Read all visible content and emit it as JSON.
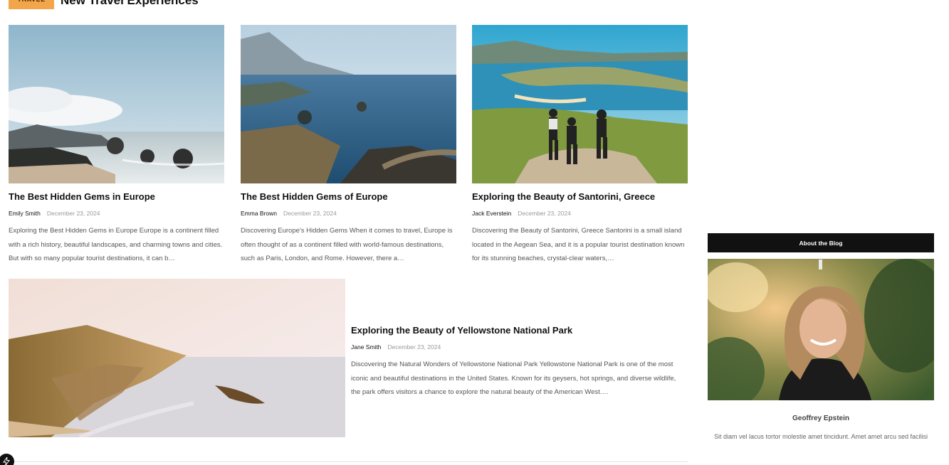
{
  "section": {
    "badge": "TRAVEL",
    "title": "New Travel Experiences"
  },
  "posts": [
    {
      "title": "The Best Hidden Gems in Europe",
      "author": "Emily Smith",
      "date": "December 23, 2024",
      "excerpt": "Exploring the Best Hidden Gems in Europe Europe is a continent filled with a rich history, beautiful landscapes, and charming towns and cities. But with so many popular tourist destinations, it can b…"
    },
    {
      "title": "The Best Hidden Gems of Europe",
      "author": "Emma Brown",
      "date": "December 23, 2024",
      "excerpt": "Discovering Europe's Hidden Gems When it comes to travel, Europe is often thought of as a continent filled with world-famous destinations, such as Paris, London, and Rome. However, there a…"
    },
    {
      "title": "Exploring the Beauty of Santorini, Greece",
      "author": "Jack Everstein",
      "date": "December 23, 2024",
      "excerpt": "Discovering the Beauty of Santorini, Greece Santorini is a small island located in the Aegean Sea, and it is a popular tourist destination known for its stunning beaches, crystal-clear waters,…"
    },
    {
      "title": "Exploring the Beauty of Yellowstone National Park",
      "author": "Jane Smith",
      "date": "December 23, 2024",
      "excerpt": "Discovering the Natural Wonders of Yellowstone National Park Yellowstone National Park is one of the most iconic and beautiful destinations in the United States. Known for its geysers, hot springs, and diverse wildlife, the park offers visitors a chance to explore the natural beauty of the American West.…"
    }
  ],
  "sidebar": {
    "heading": "About the Blog",
    "name": "Geoffrey Epstein",
    "bio": "Sit diam vel lacus tortor molestie amet tincidunt. Amet amet arcu sed facilisi"
  },
  "icons": {
    "corner": "lightning-icon"
  },
  "colors": {
    "badge": "#f2a54a",
    "sidebar_header": "#111111"
  }
}
